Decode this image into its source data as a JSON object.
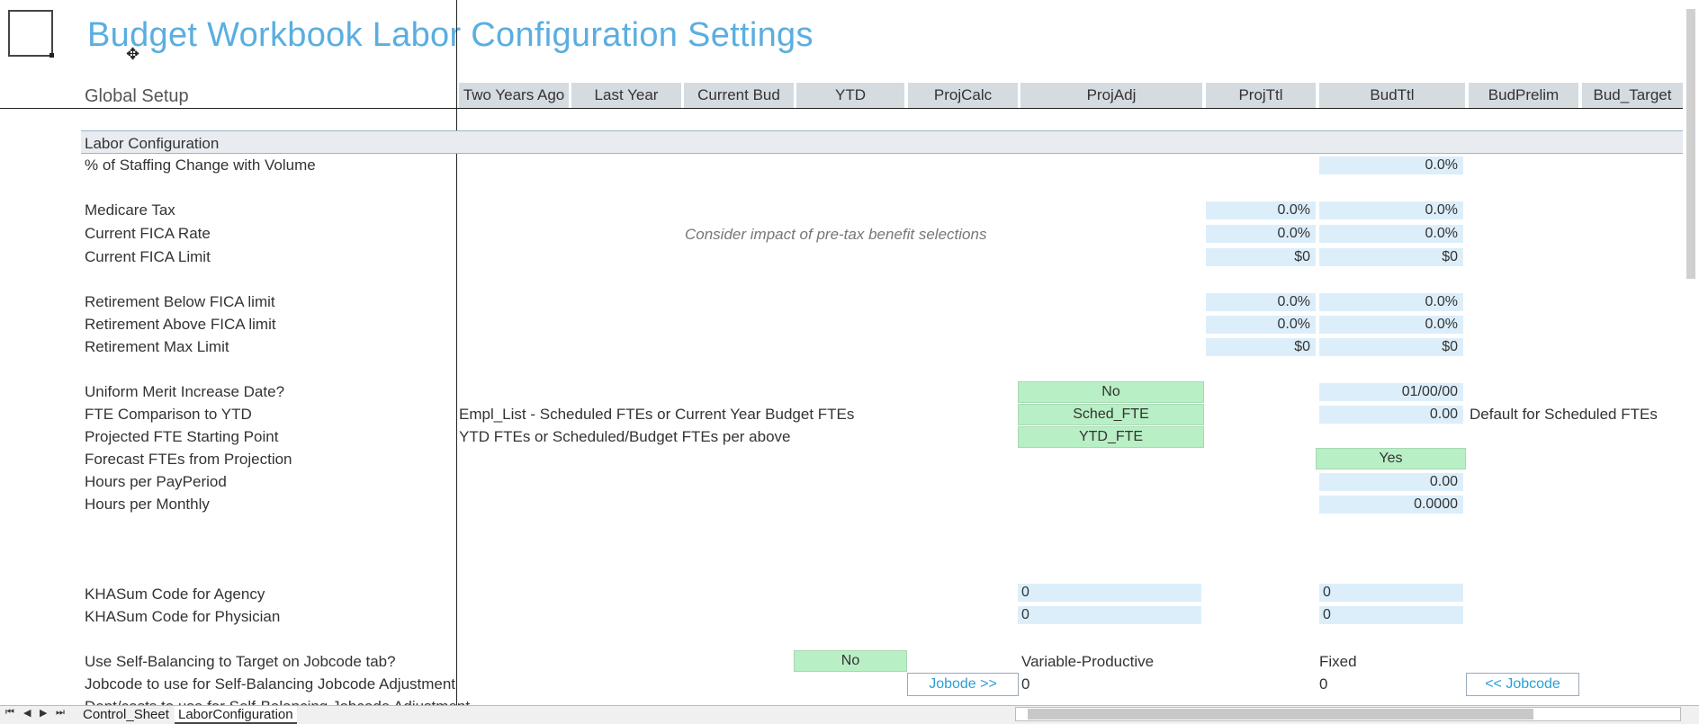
{
  "header": {
    "title": "Budget Workbook Labor Configuration Settings",
    "subtitle": "Global Setup"
  },
  "columns": [
    "Two Years Ago",
    "Last Year",
    "Current Bud",
    "YTD",
    "ProjCalc",
    "ProjAdj",
    "ProjTtl",
    "BudTtl",
    "BudPrelim",
    "Bud_Target"
  ],
  "section": {
    "label": "Labor Configuration"
  },
  "rows": {
    "staffing_change": {
      "label": "% of Staffing Change with Volume",
      "budttl": "0.0%"
    },
    "medicare": {
      "label": "Medicare Tax",
      "projttl": "0.0%",
      "budttl": "0.0%"
    },
    "fica_rate": {
      "label": "Current FICA Rate",
      "projttl": "0.0%",
      "budttl": "0.0%"
    },
    "fica_limit": {
      "label": "Current FICA Limit",
      "projttl": "$0",
      "budttl": "$0"
    },
    "ret_below": {
      "label": "Retirement Below FICA limit",
      "projttl": "0.0%",
      "budttl": "0.0%"
    },
    "ret_above": {
      "label": "Retirement Above FICA limit",
      "projttl": "0.0%",
      "budttl": "0.0%"
    },
    "ret_max": {
      "label": "Retirement Max Limit",
      "projttl": "$0",
      "budttl": "$0"
    },
    "merit_date": {
      "label": "Uniform Merit Increase Date?",
      "projadj": "No",
      "budttl": "01/00/00"
    },
    "fte_comparison": {
      "label": "FTE Comparison to YTD",
      "note": "Empl_List - Scheduled FTEs or Current Year Budget FTEs",
      "projadj": "Sched_FTE",
      "budttl": "0.00",
      "note_right": "Default for Scheduled FTEs"
    },
    "fte_start": {
      "label": "Projected FTE Starting Point",
      "note": "YTD FTEs or Scheduled/Budget FTEs per above",
      "projadj": "YTD_FTE"
    },
    "forecast_fte": {
      "label": "Forecast FTEs from Projection",
      "budttl": "Yes"
    },
    "hours_payperiod": {
      "label": "Hours per PayPeriod",
      "budttl": "0.00"
    },
    "hours_monthly": {
      "label": "Hours per Monthly",
      "budttl": "0.0000"
    },
    "khasum_agency": {
      "label": "KHASum Code for Agency",
      "projadj": "0",
      "budttl": "0"
    },
    "khasum_physician": {
      "label": "KHASum Code for Physician",
      "projadj": "0",
      "budttl": "0"
    },
    "self_balancing": {
      "label": "Use Self-Balancing to Target on Jobcode tab?",
      "ytd": "No",
      "projadj": "Variable-Productive",
      "budttl": "Fixed"
    },
    "jobcode_adjust": {
      "label": "Jobcode to use for Self-Balancing Jobcode Adjustment",
      "projcalc_btn": "Jobode >>",
      "projadj": "0",
      "budttl": "0",
      "budprelim_btn": "<< Jobcode"
    },
    "partial_row": {
      "label": "Dept/costs to use for Self-Balancing Jobcode Adjustment"
    }
  },
  "pretax_note": "Consider impact of pre-tax benefit selections",
  "sheet_tabs": {
    "tab1": "Control_Sheet",
    "tab2": "LaborConfiguration"
  }
}
